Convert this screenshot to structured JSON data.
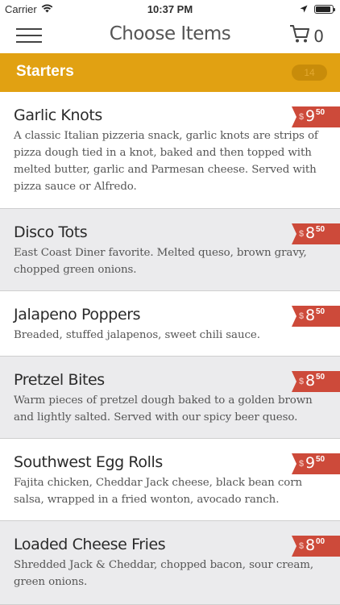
{
  "status_bar": {
    "carrier": "Carrier",
    "time": "10:37 PM",
    "battery_level": 0.92
  },
  "nav": {
    "title": "Choose Items",
    "cart_count": "0"
  },
  "category": {
    "title": "Starters",
    "count": "14"
  },
  "items": [
    {
      "name": "Garlic Knots",
      "description": "A classic Italian pizzeria snack, garlic knots are strips of pizza dough tied in a knot, baked and then topped with melted butter, garlic and Parmesan cheese. Served with pizza sauce or Alfredo.",
      "price_currency": "$",
      "price_dollars": "9",
      "price_cents": "50"
    },
    {
      "name": "Disco Tots",
      "description": "East Coast Diner favorite. Melted queso, brown gravy, chopped green onions.",
      "price_currency": "$",
      "price_dollars": "8",
      "price_cents": "50"
    },
    {
      "name": "Jalapeno Poppers",
      "description": "Breaded, stuffed jalapenos, sweet chili sauce.",
      "price_currency": "$",
      "price_dollars": "8",
      "price_cents": "50"
    },
    {
      "name": "Pretzel Bites",
      "description": "Warm pieces of pretzel dough baked to a golden brown and lightly salted. Served with our spicy beer queso.",
      "price_currency": "$",
      "price_dollars": "8",
      "price_cents": "50"
    },
    {
      "name": "Southwest Egg Rolls",
      "description": "Fajita chicken, Cheddar Jack cheese, black bean corn salsa, wrapped in a fried wonton, avocado ranch.",
      "price_currency": "$",
      "price_dollars": "9",
      "price_cents": "50"
    },
    {
      "name": "Loaded Cheese Fries",
      "description": "Shredded Jack & Cheddar, chopped bacon, sour cream, green onions.",
      "price_currency": "$",
      "price_dollars": "8",
      "price_cents": "00"
    }
  ],
  "colors": {
    "category_bar": "#e1a112",
    "price_tag": "#cd4a3a",
    "alt_row": "#ebebed"
  },
  "icons": {
    "menu": "hamburger-icon",
    "cart": "cart-icon",
    "wifi": "wifi-icon",
    "location": "location-arrow-icon",
    "battery": "battery-icon"
  }
}
